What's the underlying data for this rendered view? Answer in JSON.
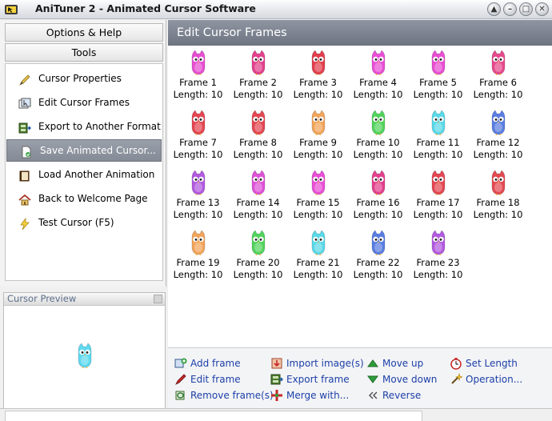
{
  "window": {
    "title": "AniTuner 2 - Animated Cursor Software",
    "controls": [
      "up-icon",
      "minimize-icon",
      "maximize-icon",
      "close-icon"
    ]
  },
  "left_panel": {
    "options_help": "Options & Help",
    "tools": "Tools",
    "tasks": [
      {
        "label": "Cursor Properties",
        "icon": "pencil-icon",
        "selected": false
      },
      {
        "label": "Edit Cursor Frames",
        "icon": "frames-icon",
        "selected": false
      },
      {
        "label": "Export to Another Format",
        "icon": "export-film-icon",
        "selected": false
      },
      {
        "label": "Save Animated Cursor...",
        "icon": "save-doc-icon",
        "selected": true
      },
      {
        "label": "Load Another Animation",
        "icon": "load-book-icon",
        "selected": false
      },
      {
        "label": "Back to Welcome Page",
        "icon": "home-icon",
        "selected": false
      },
      {
        "label": "Test Cursor (F5)",
        "icon": "lightning-icon",
        "selected": false
      }
    ]
  },
  "preview": {
    "title": "Cursor Preview",
    "color": "#5fd9ef"
  },
  "main": {
    "title": "Edit Cursor Frames",
    "frames": [
      {
        "name": "Frame 1",
        "length": "Length: 10",
        "color": "#e64fd2"
      },
      {
        "name": "Frame 2",
        "length": "Length: 10",
        "color": "#e2418d"
      },
      {
        "name": "Frame 3",
        "length": "Length: 10",
        "color": "#e23f4e"
      },
      {
        "name": "Frame 4",
        "length": "Length: 10",
        "color": "#e94fd6"
      },
      {
        "name": "Frame 5",
        "length": "Length: 10",
        "color": "#e84ed3"
      },
      {
        "name": "Frame 6",
        "length": "Length: 10",
        "color": "#e54a8c"
      },
      {
        "name": "Frame 7",
        "length": "Length: 10",
        "color": "#e44652"
      },
      {
        "name": "Frame 8",
        "length": "Length: 10",
        "color": "#e34753"
      },
      {
        "name": "Frame 9",
        "length": "Length: 10",
        "color": "#f2a55b"
      },
      {
        "name": "Frame 10",
        "length": "Length: 10",
        "color": "#52d35d"
      },
      {
        "name": "Frame 11",
        "length": "Length: 10",
        "color": "#5ad9e8"
      },
      {
        "name": "Frame 12",
        "length": "Length: 10",
        "color": "#5a7de0"
      },
      {
        "name": "Frame 13",
        "length": "Length: 10",
        "color": "#b25ae0"
      },
      {
        "name": "Frame 14",
        "length": "Length: 10",
        "color": "#de52d8"
      },
      {
        "name": "Frame 15",
        "length": "Length: 10",
        "color": "#e94fd6"
      },
      {
        "name": "Frame 16",
        "length": "Length: 10",
        "color": "#e2418d"
      },
      {
        "name": "Frame 17",
        "length": "Length: 10",
        "color": "#e34753"
      },
      {
        "name": "Frame 18",
        "length": "Length: 10",
        "color": "#e24a52"
      },
      {
        "name": "Frame 19",
        "length": "Length: 10",
        "color": "#f2a55b"
      },
      {
        "name": "Frame 20",
        "length": "Length: 10",
        "color": "#52d35d"
      },
      {
        "name": "Frame 21",
        "length": "Length: 10",
        "color": "#5ad9e8"
      },
      {
        "name": "Frame 22",
        "length": "Length: 10",
        "color": "#5a7de0"
      },
      {
        "name": "Frame 23",
        "length": "Length: 10",
        "color": "#b25ae0"
      }
    ]
  },
  "actions": [
    {
      "label": "Add frame",
      "icon": "add-frame-icon",
      "color": "#2e7d32"
    },
    {
      "label": "Edit frame",
      "icon": "edit-frame-icon",
      "color": "#c62828"
    },
    {
      "label": "Remove frame(s)",
      "icon": "remove-frame-icon",
      "color": "#2e7d32"
    },
    {
      "label": "Import image(s)",
      "icon": "import-image-icon",
      "color": "#c62828"
    },
    {
      "label": "Export frame",
      "icon": "export-frame-icon",
      "color": "#2e7d32"
    },
    {
      "label": "Merge with...",
      "icon": "merge-icon",
      "color": "#c62828"
    },
    {
      "label": "Move up",
      "icon": "move-up-icon",
      "color": "#2e9e3c"
    },
    {
      "label": "Move down",
      "icon": "move-down-icon",
      "color": "#2e9e3c"
    },
    {
      "label": "Reverse",
      "icon": "reverse-icon",
      "color": "#555555"
    },
    {
      "label": "Set Length",
      "icon": "stopwatch-icon",
      "color": "#c62828"
    },
    {
      "label": "Operation...",
      "icon": "wand-icon",
      "color": "#d4a017"
    }
  ]
}
